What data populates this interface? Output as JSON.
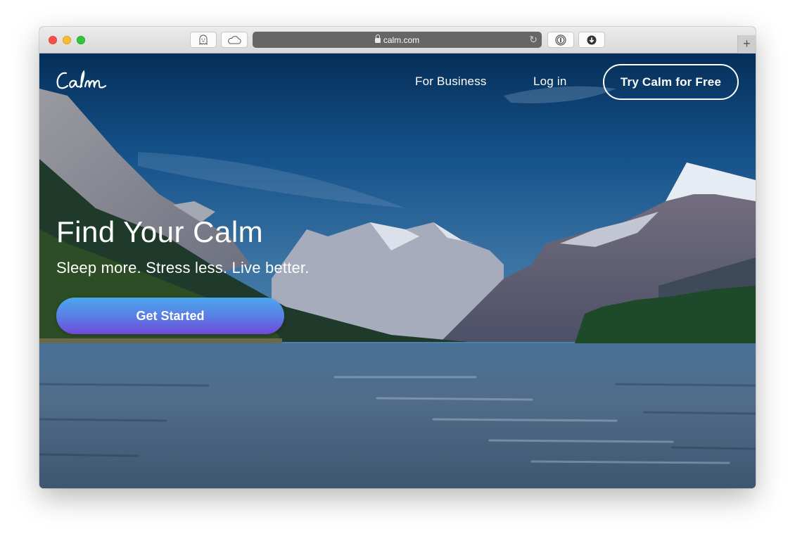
{
  "browser": {
    "url": "calm.com",
    "toolbar_left": [
      {
        "name": "ghostery-extension-button",
        "icon": "ghost-icon"
      },
      {
        "name": "icloud-tabs-button",
        "icon": "cloud-icon"
      }
    ],
    "toolbar_right": [
      {
        "name": "1password-extension-button",
        "icon": "1password-icon"
      },
      {
        "name": "downloads-button",
        "icon": "download-arrow-icon"
      }
    ],
    "new_tab_label": "+"
  },
  "nav": {
    "logo_text": "Calm",
    "links": [
      {
        "label": "For Business"
      },
      {
        "label": "Log in"
      }
    ],
    "cta_label": "Try Calm for Free"
  },
  "hero": {
    "title": "Find Your Calm",
    "subtitle": "Sleep more. Stress less. Live better.",
    "button_label": "Get Started",
    "button_gradient": [
      "#4ba8ee",
      "#7049d8"
    ]
  },
  "background": {
    "description": "Mountain lake landscape with snow-capped peaks, pine forests and rippled water reflection"
  }
}
